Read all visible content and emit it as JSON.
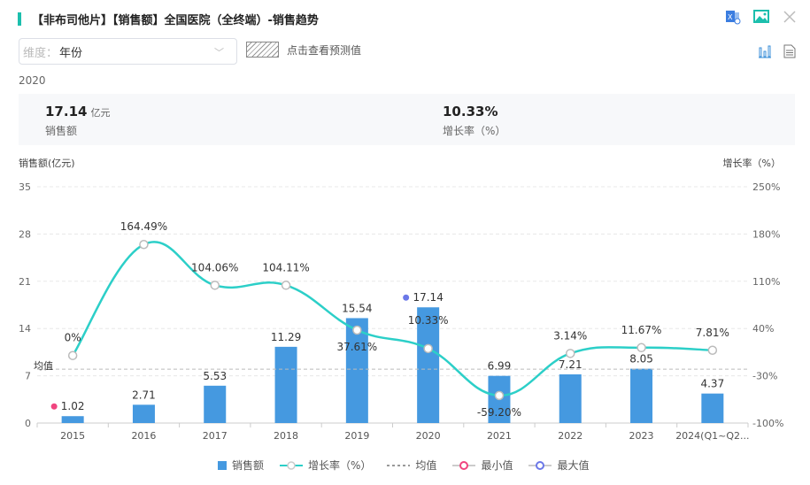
{
  "header": {
    "title": "【非布司他片】【销售额】全国医院（全终端）-销售趋势"
  },
  "toolbar": {
    "dimension_label": "维度：",
    "dimension_value": "年份",
    "forecast_label": "点击查看预测值"
  },
  "selected_year": "2020",
  "kpis": [
    {
      "value": "17.14",
      "unit": "亿元",
      "name": "销售额"
    },
    {
      "value": "10.33%",
      "unit": "",
      "name": "增长率（%）"
    }
  ],
  "colors": {
    "bar": "#4599e0",
    "line": "#2ccfc8",
    "min": "#f0457f",
    "max": "#6b78e8",
    "accent": "#1cbfad"
  },
  "chart_data": {
    "type": "bar+line",
    "categories": [
      "2015",
      "2016",
      "2017",
      "2018",
      "2019",
      "2020",
      "2021",
      "2022",
      "2023",
      "2024(Q1~Q2..."
    ],
    "series": [
      {
        "name": "销售额",
        "type": "bar",
        "axis": "left",
        "values": [
          1.02,
          2.71,
          5.53,
          11.29,
          15.54,
          17.14,
          6.99,
          7.21,
          8.05,
          4.37
        ],
        "labels": [
          "1.02",
          "2.71",
          "5.53",
          "11.29",
          "15.54",
          "17.14",
          "6.99",
          "7.21",
          "8.05",
          "4.37"
        ]
      },
      {
        "name": "增长率（%）",
        "type": "line",
        "axis": "right",
        "values": [
          0,
          164.49,
          104.06,
          104.11,
          37.61,
          10.33,
          -59.2,
          3.14,
          11.67,
          7.81
        ],
        "labels": [
          "0%",
          "164.49%",
          "104.06%",
          "104.11%",
          "37.61%",
          "10.33%",
          "-59.20%",
          "3.14%",
          "11.67%",
          "7.81%"
        ]
      }
    ],
    "mean": {
      "label": "均值",
      "value": 7.985
    },
    "ylabel_left": "销售额(亿元)",
    "ylabel_right": "增长率（%）",
    "ylim_left": [
      0,
      35
    ],
    "yticks_left": [
      "0",
      "7",
      "14",
      "21",
      "28",
      "35"
    ],
    "ylim_right": [
      -100,
      250
    ],
    "yticks_right": [
      "-100%",
      "-30%",
      "40%",
      "110%",
      "180%",
      "250%"
    ],
    "legend": [
      "销售额",
      "增长率（%）",
      "均值",
      "最小值",
      "最大值"
    ],
    "legend_position": "bottom"
  }
}
